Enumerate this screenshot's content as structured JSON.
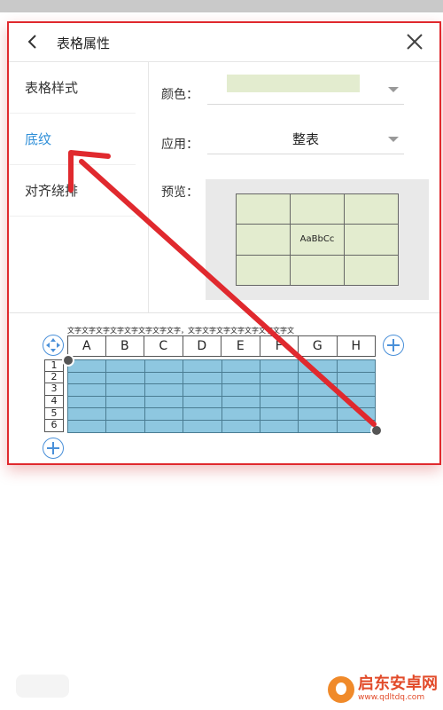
{
  "dialog": {
    "title": "表格属性"
  },
  "nav": {
    "items": [
      {
        "label": "表格样式"
      },
      {
        "label": "底纹"
      },
      {
        "label": "对齐绕排"
      }
    ],
    "active_index": 1
  },
  "settings": {
    "color_label": "颜色：",
    "color_value": "#e3eccf",
    "apply_label": "应用：",
    "apply_value": "整表",
    "preview_label": "预览：",
    "preview_sample_text": "AaBbCc"
  },
  "sheet": {
    "text_strip": "文字文字文字文字文字文字文字文字，文字文字文字文字文字文字文字文",
    "columns": [
      "A",
      "B",
      "C",
      "D",
      "E",
      "F",
      "G",
      "H"
    ],
    "rows": [
      "1",
      "2",
      "3",
      "4",
      "5",
      "6"
    ],
    "cell_color": "#8ec7e0"
  },
  "annotation": {
    "arrow_color": "#e0292e"
  },
  "watermark": {
    "title": "启东安卓网",
    "url": "www.qdltdq.com"
  }
}
